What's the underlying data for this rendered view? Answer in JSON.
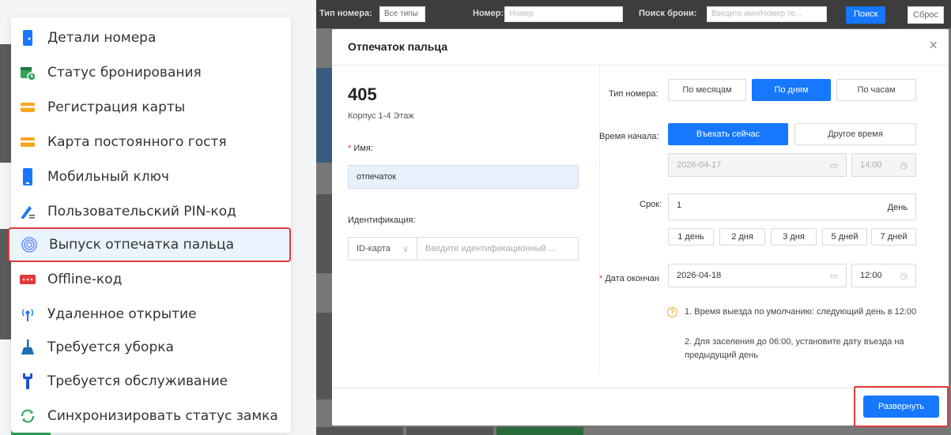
{
  "menu": {
    "items": [
      {
        "label": "Детали номера",
        "icon": "room-info-icon",
        "color": "#1677ff"
      },
      {
        "label": "Статус бронирования",
        "icon": "booking-status-icon",
        "color": "#2fa35a"
      },
      {
        "label": "Регистрация карты",
        "icon": "card-register-icon",
        "color": "#f5a623"
      },
      {
        "label": "Карта постоянного гостя",
        "icon": "regular-guest-card-icon",
        "color": "#f5a623"
      },
      {
        "label": "Мобильный ключ",
        "icon": "mobile-key-icon",
        "color": "#1677ff"
      },
      {
        "label": "Пользовательский PIN-код",
        "icon": "pin-code-icon",
        "color": "#1677ff"
      },
      {
        "label": "Выпуск отпечатка пальца",
        "icon": "fingerprint-icon",
        "color": "#6a8cff"
      },
      {
        "label": "Offline-код",
        "icon": "offline-code-icon",
        "color": "#e03a3a"
      },
      {
        "label": "Удаленное открытие",
        "icon": "remote-open-icon",
        "color": "#1677ff"
      },
      {
        "label": "Требуется уборка",
        "icon": "cleaning-icon",
        "color": "#1a6fb5"
      },
      {
        "label": "Требуется обслуживание",
        "icon": "maintenance-icon",
        "color": "#1a4fd0"
      },
      {
        "label": "Синхронизировать статус замка",
        "icon": "sync-icon",
        "color": "#2fa35a"
      }
    ],
    "selected_index": 6
  },
  "filter_bar": {
    "room_type_label": "Тип номера:",
    "room_type_value": "Все типы",
    "room_no_label": "Номер:",
    "room_no_placeholder": "Номер",
    "booking_search_label": "Поиск брони:",
    "booking_search_placeholder": "Введите имя/Номер те...",
    "search_button": "Поиск",
    "reset_button": "Сброс"
  },
  "modal": {
    "title": "Отпечаток пальца",
    "close_symbol": "×",
    "room_number": "405",
    "room_location": "Корпус 1-4 Этаж",
    "name_label": "Имя:",
    "name_value": "отпечаток",
    "id_label": "Идентификация:",
    "id_type": "ID-карта",
    "id_placeholder": "Введите идентификационный ...",
    "room_type_label": "Тип номера:",
    "room_type_options": [
      "По месяцам",
      "По дням",
      "По часам"
    ],
    "room_type_selected": 1,
    "start_time_label": "Время начала:",
    "start_time_options": [
      "Въехать сейчас",
      "Другое время"
    ],
    "start_time_selected": 0,
    "start_date": "2026-04-17",
    "start_hour": "14:00",
    "term_label": "Срок:",
    "term_value": "1",
    "term_unit": "День",
    "term_chips": [
      "1 день",
      "2 дня",
      "3 дня",
      "5 дней",
      "7 дней"
    ],
    "end_date_label": "Дата окончан",
    "end_date": "2026-04-18",
    "end_hour": "12:00",
    "notes": [
      "1. Время выезда по умолчанию: следующий день в 12:00",
      "2. Для заселения до 06:00, установите дату въезда на предыдущий день"
    ],
    "expand_button": "Развернуть"
  },
  "colors": {
    "accent": "#1677ff",
    "highlight": "#e03a3a",
    "warning": "#f5a623"
  }
}
